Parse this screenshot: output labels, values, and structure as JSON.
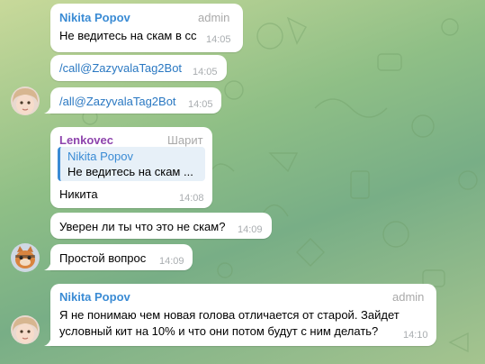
{
  "colors": {
    "accent_blue": "#2a78c2",
    "name_blue": "#3a8bd4",
    "name_purple": "#8e44ad",
    "bubble": "#ffffff",
    "time_gray": "#a9adb0"
  },
  "messages": [
    {
      "author": "Nikita Popov",
      "role": "admin",
      "text": "Не ведитесь на скам в сс",
      "time": "14:05"
    },
    {
      "text": "/call@ZazyvalaTag2Bot",
      "time": "14:05"
    },
    {
      "text": "/all@ZazyvalaTag2Bot",
      "time": "14:05",
      "avatar": "girl-avatar"
    },
    {
      "author": "Lenkovec",
      "role": "Шарит",
      "reply": {
        "author": "Nikita Popov",
        "text": "Не ведитесь на скам ..."
      },
      "text": "Никита",
      "time": "14:08"
    },
    {
      "text": "Уверен ли ты что это не скам?",
      "time": "14:09"
    },
    {
      "text": "Простой вопрос",
      "time": "14:09",
      "avatar": "cat-sticker-avatar"
    },
    {
      "author": "Nikita Popov",
      "role": "admin",
      "lines": [
        "Я не понимаю чем новая голова отличается от старой. Зайдет",
        "условный кит на 10% и что они потом будут с ним делать?"
      ],
      "time": "14:10",
      "avatar": "girl-avatar"
    }
  ]
}
